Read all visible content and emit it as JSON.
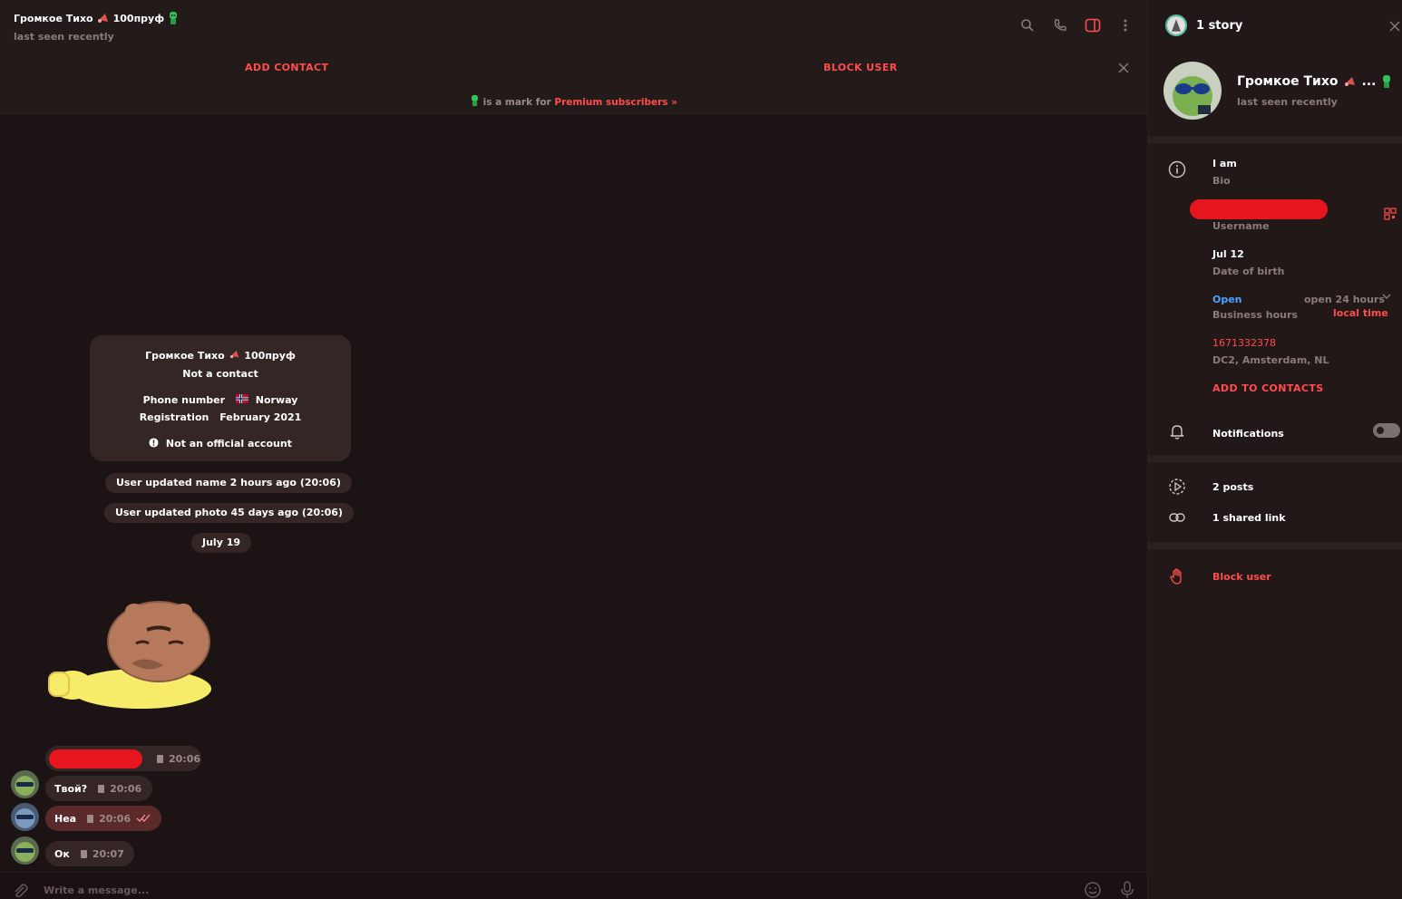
{
  "colors": {
    "accent": "#ff4d4d",
    "open": "#4aa3ff",
    "background": "#1c1414",
    "panel": "#221818",
    "bubble": "#352626",
    "bubble_out": "#5a2a2a",
    "redaction": "#e5161d"
  },
  "header": {
    "title": "Громкое Тихо",
    "title_suffix": "100пруф",
    "status": "last seen recently",
    "icons": [
      "search-icon",
      "phone-icon",
      "sidebar-toggle-icon",
      "more-vertical-icon"
    ]
  },
  "action_bar": {
    "add_contact": "ADD CONTACT",
    "block_user": "BLOCK USER",
    "premium_text": "is a mark for",
    "premium_link": "Premium subscribers »"
  },
  "info_card": {
    "name": "Громкое Тихо",
    "name_suffix": "100пруф",
    "status": "Not a contact",
    "phone_label": "Phone number",
    "phone_value": "Norway",
    "registration_label": "Registration",
    "registration_value": "February 2021",
    "official": "Not an official account"
  },
  "service_messages": [
    "User updated name 2 hours ago (20:06)",
    "User updated photo 45 days ago (20:06)",
    "July 19"
  ],
  "messages": [
    {
      "text": "",
      "time": "20:06",
      "outgoing": false,
      "redacted": true
    },
    {
      "text": "Твой?",
      "time": "20:06",
      "outgoing": false,
      "redacted": false
    },
    {
      "text": "Неа",
      "time": "20:06",
      "outgoing": true,
      "redacted": false
    },
    {
      "text": "Ок",
      "time": "20:07",
      "outgoing": false,
      "redacted": false
    }
  ],
  "composer": {
    "placeholder": "Write a message..."
  },
  "panel": {
    "story": "1 story",
    "name": "Громкое Тихо",
    "name_ellipsis": "...",
    "status": "last seen recently",
    "bio_value": "I am",
    "bio_label": "Bio",
    "username_label": "Username",
    "birth_value": "Jul 12",
    "birth_label": "Date of birth",
    "hours_status": "Open",
    "hours_value": "open 24 hours",
    "hours_label": "Business hours",
    "hours_link": "local time",
    "phone": "1671332378",
    "dc": "DC2, Amsterdam, NL",
    "add_contacts": "ADD TO CONTACTS",
    "notifications": "Notifications",
    "posts": "2 posts",
    "shared_link": "1 shared link",
    "block_user": "Block user"
  }
}
